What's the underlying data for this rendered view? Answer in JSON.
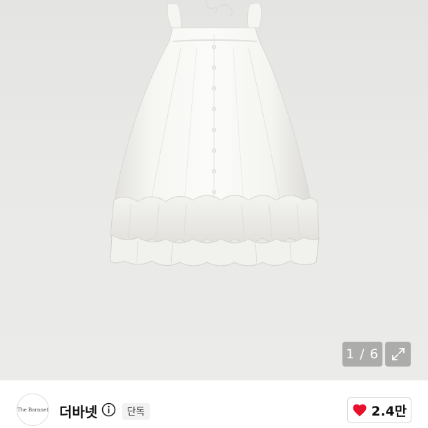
{
  "gallery": {
    "current": 1,
    "total": 6,
    "counter_text": "1 / 6"
  },
  "brand": {
    "logo_text": "The Barnnet",
    "name": "더바넷",
    "badge": "단독"
  },
  "likes": {
    "count_label": "2.4만",
    "heart_color": "#e8112d"
  },
  "icons": [
    "expand-icon",
    "info-icon",
    "heart-icon"
  ]
}
